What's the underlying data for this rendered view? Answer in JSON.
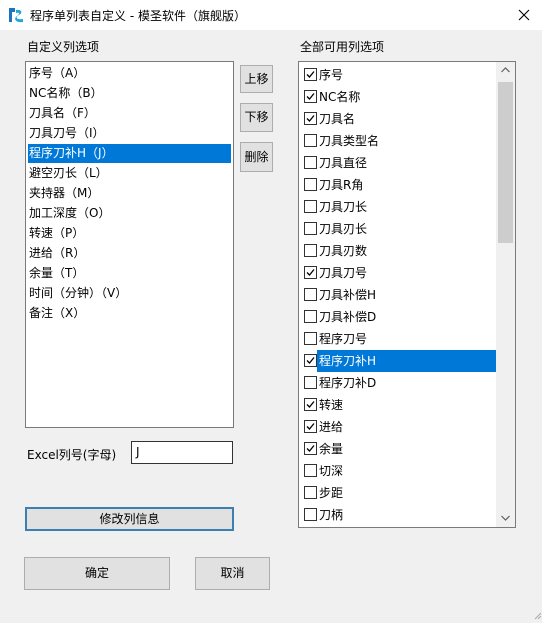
{
  "window": {
    "title": "程序单列表自定义 - 模圣软件（旗舰版）",
    "icon": "app-logo-icon"
  },
  "custom_list": {
    "label": "自定义列选项",
    "items": [
      {
        "label": "序号（A）",
        "selected": false
      },
      {
        "label": "NC名称（B）",
        "selected": false
      },
      {
        "label": "刀具名（F）",
        "selected": false
      },
      {
        "label": "刀具刀号（I）",
        "selected": false
      },
      {
        "label": "程序刀补H（J）",
        "selected": true
      },
      {
        "label": "避空刃长（L）",
        "selected": false
      },
      {
        "label": "夹持器（M）",
        "selected": false
      },
      {
        "label": "加工深度（O）",
        "selected": false
      },
      {
        "label": "转速（P）",
        "selected": false
      },
      {
        "label": "进给（R）",
        "selected": false
      },
      {
        "label": "余量（T）",
        "selected": false
      },
      {
        "label": "时间（分钟）（V）",
        "selected": false
      },
      {
        "label": "备注（X）",
        "selected": false
      }
    ]
  },
  "buttons": {
    "up": "上移",
    "down": "下移",
    "delete": "删除",
    "modify": "修改列信息",
    "ok": "确定",
    "cancel": "取消"
  },
  "excel_column": {
    "label": "Excel列号(字母)",
    "value": "J"
  },
  "all_list": {
    "label": "全部可用列选项",
    "items": [
      {
        "label": "序号",
        "checked": true,
        "selected": false
      },
      {
        "label": "NC名称",
        "checked": true,
        "selected": false
      },
      {
        "label": "刀具名",
        "checked": true,
        "selected": false
      },
      {
        "label": "刀具类型名",
        "checked": false,
        "selected": false
      },
      {
        "label": "刀具直径",
        "checked": false,
        "selected": false
      },
      {
        "label": "刀具R角",
        "checked": false,
        "selected": false
      },
      {
        "label": "刀具刀长",
        "checked": false,
        "selected": false
      },
      {
        "label": "刀具刃长",
        "checked": false,
        "selected": false
      },
      {
        "label": "刀具刃数",
        "checked": false,
        "selected": false
      },
      {
        "label": "刀具刀号",
        "checked": true,
        "selected": false
      },
      {
        "label": "刀具补偿H",
        "checked": false,
        "selected": false
      },
      {
        "label": "刀具补偿D",
        "checked": false,
        "selected": false
      },
      {
        "label": "程序刀号",
        "checked": false,
        "selected": false
      },
      {
        "label": "程序刀补H",
        "checked": true,
        "selected": true
      },
      {
        "label": "程序刀补D",
        "checked": false,
        "selected": false
      },
      {
        "label": "转速",
        "checked": true,
        "selected": false
      },
      {
        "label": "进给",
        "checked": true,
        "selected": false
      },
      {
        "label": "余量",
        "checked": true,
        "selected": false
      },
      {
        "label": "切深",
        "checked": false,
        "selected": false
      },
      {
        "label": "步距",
        "checked": false,
        "selected": false
      },
      {
        "label": "刀柄",
        "checked": false,
        "selected": false
      }
    ]
  },
  "colors": {
    "selection": "#0078d7",
    "window_bg": "#f0f0f0",
    "focus_border": "#3c7fb1"
  }
}
